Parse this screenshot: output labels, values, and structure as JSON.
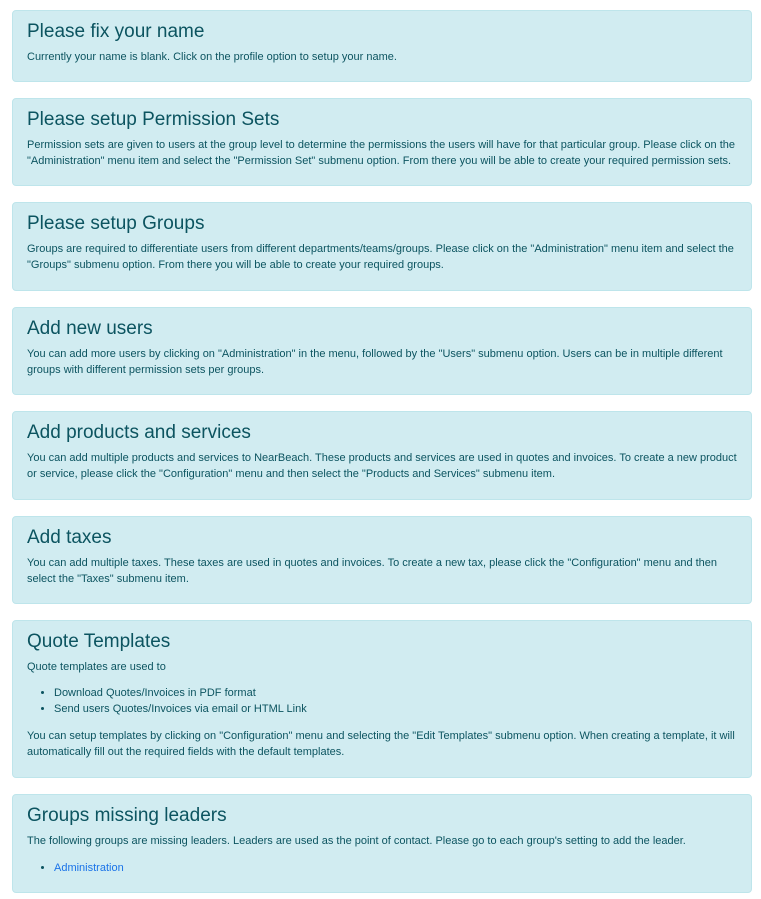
{
  "alerts": {
    "name": {
      "title": "Please fix your name",
      "text": "Currently your name is blank. Click on the profile option to setup your name."
    },
    "permission_sets": {
      "title": "Please setup Permission Sets",
      "text": "Permission sets are given to users at the group level to determine the permissions the users will have for that particular group. Please click on the \"Administration\" menu item and select the \"Permission Set\" submenu option. From there you will be able to create your required permission sets."
    },
    "groups": {
      "title": "Please setup Groups",
      "text": "Groups are required to differentiate users from different departments/teams/groups. Please click on the \"Administration\" menu item and select the \"Groups\" submenu option. From there you will be able to create your required groups."
    },
    "users": {
      "title": "Add new users",
      "text": "You can add more users by clicking on \"Administration\" in the menu, followed by the \"Users\" submenu option. Users can be in multiple different groups with different permission sets per groups."
    },
    "products": {
      "title": "Add products and services",
      "text": "You can add multiple products and services to NearBeach. These products and services are used in quotes and invoices. To create a new product or service, please click the \"Configuration\" menu and then select the \"Products and Services\" submenu item."
    },
    "taxes": {
      "title": "Add taxes",
      "text": "You can add multiple taxes. These taxes are used in quotes and invoices. To create a new tax, please click the \"Configuration\" menu and then select the \"Taxes\" submenu item."
    },
    "quote_templates": {
      "title": "Quote Templates",
      "intro": "Quote templates are used to",
      "items": [
        "Download Quotes/Invoices in PDF format",
        "Send users Quotes/Invoices via email or HTML Link"
      ],
      "outro": "You can setup templates by clicking on \"Configuration\" menu and selecting the \"Edit Templates\" submenu option. When creating a template, it will automatically fill out the required fields with the default templates."
    },
    "leaders": {
      "title": "Groups missing leaders",
      "text": "The following groups are missing leaders. Leaders are used as the point of contact. Please go to each group's setting to add the leader.",
      "groups": [
        "Administration"
      ]
    }
  }
}
